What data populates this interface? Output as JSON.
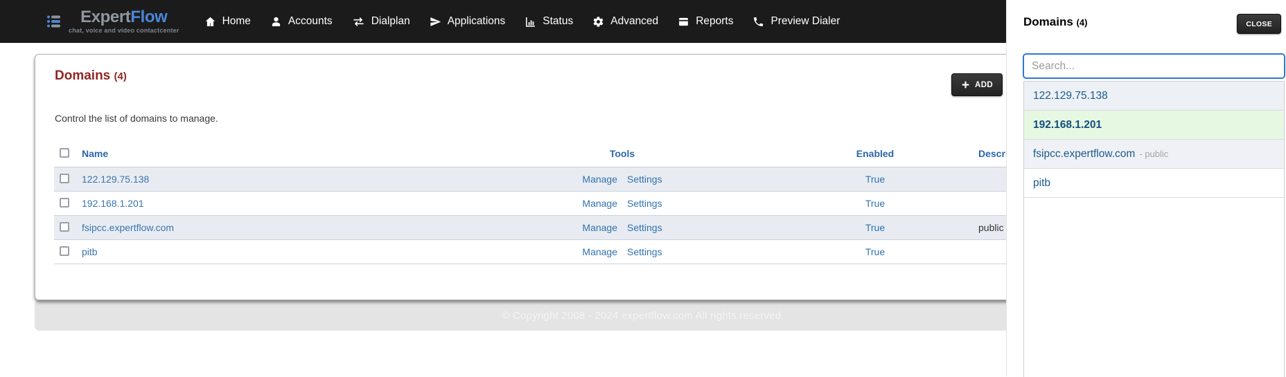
{
  "brand": {
    "name_primary": "Expert",
    "name_secondary": "Flow",
    "tagline": "chat, voice and video contactcenter"
  },
  "nav": {
    "items": [
      {
        "label": "Home",
        "icon": "home-icon"
      },
      {
        "label": "Accounts",
        "icon": "user-icon"
      },
      {
        "label": "Dialplan",
        "icon": "swap-arrows-icon"
      },
      {
        "label": "Applications",
        "icon": "paper-plane-icon"
      },
      {
        "label": "Status",
        "icon": "bar-chart-icon"
      },
      {
        "label": "Advanced",
        "icon": "gear-icon"
      },
      {
        "label": "Reports",
        "icon": "archive-icon"
      },
      {
        "label": "Preview Dialer",
        "icon": "phone-icon"
      }
    ]
  },
  "page": {
    "title": "Domains",
    "count": "(4)",
    "subtitle": "Control the list of domains to manage.",
    "add_button": {
      "label": "ADD",
      "icon": "plus-icon"
    }
  },
  "table": {
    "columns": [
      "Name",
      "Tools",
      "Enabled",
      "Description"
    ],
    "rows": [
      {
        "name": "122.129.75.138",
        "tools": [
          "Manage",
          "Settings"
        ],
        "enabled": "True",
        "description": ""
      },
      {
        "name": "192.168.1.201",
        "tools": [
          "Manage",
          "Settings"
        ],
        "enabled": "True",
        "description": ""
      },
      {
        "name": "fsipcc.expertflow.com",
        "tools": [
          "Manage",
          "Settings"
        ],
        "enabled": "True",
        "description": "public"
      },
      {
        "name": "pitb",
        "tools": [
          "Manage",
          "Settings"
        ],
        "enabled": "True",
        "description": ""
      }
    ]
  },
  "footer": {
    "copyright": "© Copyright 2008 - 2024 expertflow.com All rights reserved."
  },
  "panel": {
    "title": "Domains",
    "count": "(4)",
    "close_button": "CLOSE",
    "search": {
      "placeholder": "Search...",
      "value": ""
    },
    "items": [
      {
        "label": "122.129.75.138",
        "suffix": "",
        "variant": "shade"
      },
      {
        "label": "192.168.1.201",
        "suffix": "",
        "variant": "active"
      },
      {
        "label": "fsipcc.expertflow.com",
        "suffix": "- public",
        "variant": "shade2"
      },
      {
        "label": "pitb",
        "suffix": "",
        "variant": "plain"
      }
    ]
  },
  "colors": {
    "navbar_bg": "#1b1b1b",
    "brand_blue": "#4a86d8",
    "brand_gray": "#9097a0",
    "heading_maroon": "#8e2723",
    "link_blue": "#3172ae",
    "header_blue": "#2a66a8",
    "row_shade": "#e8ecf2",
    "panel_active_green": "#e7f8e2",
    "search_focus_border": "#2a7ad2",
    "button_dark": "#2c2c2c",
    "footer_bg": "#e4e4e4"
  }
}
